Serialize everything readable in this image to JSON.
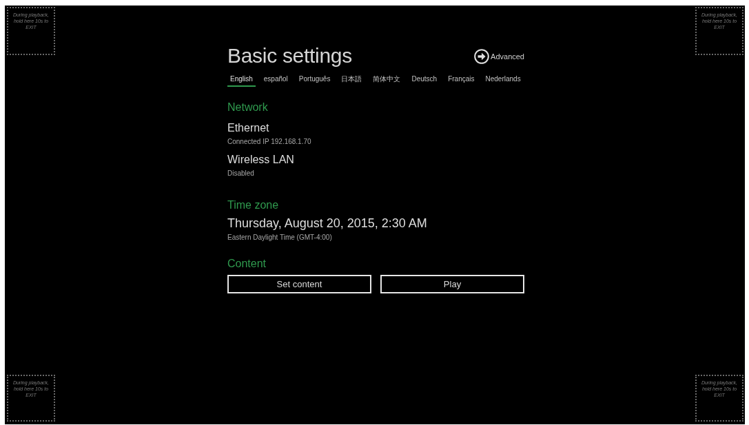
{
  "corner_hints": [
    {
      "text": "During playback, hold here 10s to EXIT"
    },
    {
      "text": "During playback, hold here 10s to EXIT"
    },
    {
      "text": "During playback, hold here 10s to EXIT"
    },
    {
      "text": "During playback, hold here 10s to EXIT"
    }
  ],
  "title": "Basic settings",
  "advanced_link": {
    "label": "Advanced"
  },
  "language_tabs": [
    {
      "label": "English",
      "selected": true
    },
    {
      "label": "español",
      "selected": false
    },
    {
      "label": "Português",
      "selected": false
    },
    {
      "label": "日本語",
      "selected": false
    },
    {
      "label": "简体中文",
      "selected": false
    },
    {
      "label": "Deutsch",
      "selected": false
    },
    {
      "label": "Français",
      "selected": false
    },
    {
      "label": "Nederlands",
      "selected": false
    }
  ],
  "sections": [
    {
      "heading": "Network",
      "items": [
        {
          "name": "Ethernet",
          "detail": "Connected IP 192.168.1.70"
        },
        {
          "name": "Wireless LAN",
          "detail": "Disabled"
        }
      ]
    },
    {
      "heading": "Time zone",
      "items": [
        {
          "name": "Thursday, August 20, 2015, 2:30 AM",
          "detail": "Eastern Daylight Time (GMT-4:00)"
        }
      ]
    },
    {
      "heading": "Content",
      "buttons": [
        "Set content",
        "Play"
      ]
    }
  ]
}
